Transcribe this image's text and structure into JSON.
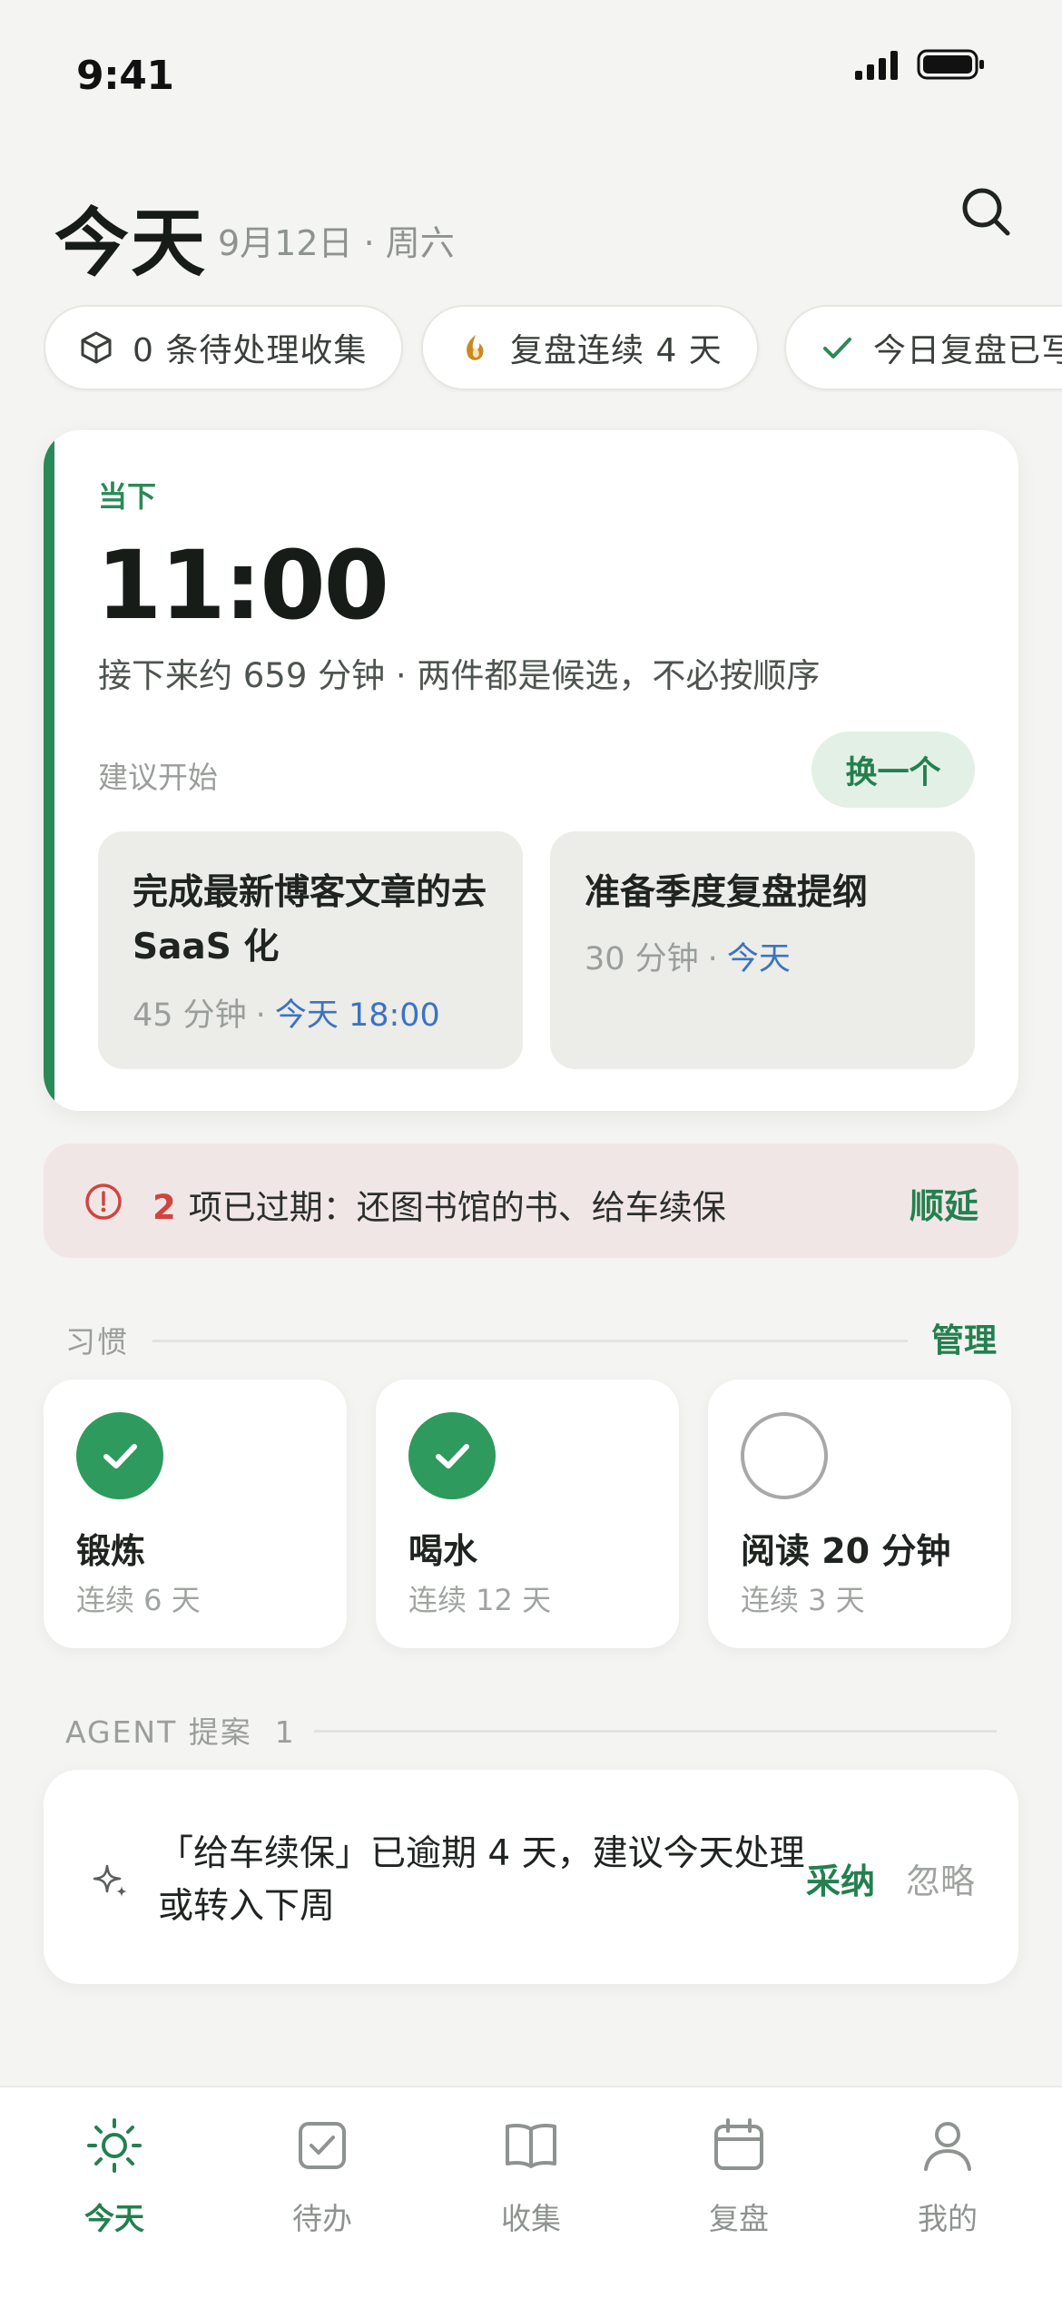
{
  "status_bar": {
    "time": "9:41"
  },
  "header": {
    "title": "今天",
    "date": "9月12日 · 周六"
  },
  "chips": [
    {
      "icon": "box-icon",
      "label": "0 条待处理收集"
    },
    {
      "icon": "flame-icon",
      "label": "复盘连续 4 天"
    },
    {
      "icon": "check-icon",
      "label": "今日复盘已写"
    }
  ],
  "now": {
    "label": "当下",
    "time": "11:00",
    "description": "接下来约 659 分钟 · 两件都是候选，不必按顺序",
    "suggest_label": "建议开始",
    "swap_label": "换一个",
    "tasks": [
      {
        "title": "完成最新博客文章的去 SaaS 化",
        "duration": "45 分钟",
        "sep": "·",
        "due": "今天 18:00"
      },
      {
        "title": "准备季度复盘提纲",
        "duration": "30 分钟",
        "sep": "·",
        "due": "今天"
      }
    ]
  },
  "overdue": {
    "count": "2",
    "text": "项已过期：还图书馆的书、给车续保",
    "action": "顺延"
  },
  "habits_section": {
    "title": "习惯",
    "action": "管理"
  },
  "habits": [
    {
      "name": "锻炼",
      "streak": "连续 6 天",
      "done": true
    },
    {
      "name": "喝水",
      "streak": "连续 12 天",
      "done": true
    },
    {
      "name": "阅读 20 分钟",
      "streak": "连续 3 天",
      "done": false
    }
  ],
  "agent_section": {
    "title": "AGENT 提案  1"
  },
  "proposal": {
    "text": "「给车续保」已逾期 4 天，建议今天处理或转入下周",
    "accept_label": "采纳",
    "ignore_label": "忽略"
  },
  "tabs": [
    {
      "icon": "sun-icon",
      "label": "今天",
      "active": true
    },
    {
      "icon": "checkbox-icon",
      "label": "待办",
      "active": false
    },
    {
      "icon": "book-icon",
      "label": "收集",
      "active": false
    },
    {
      "icon": "calendar-icon",
      "label": "复盘",
      "active": false
    },
    {
      "icon": "person-icon",
      "label": "我的",
      "active": false
    }
  ],
  "colors": {
    "accent": "#2A8A57",
    "link": "#3C72C4",
    "danger": "#D0443F",
    "overdue_bg": "#F1E6E6"
  }
}
